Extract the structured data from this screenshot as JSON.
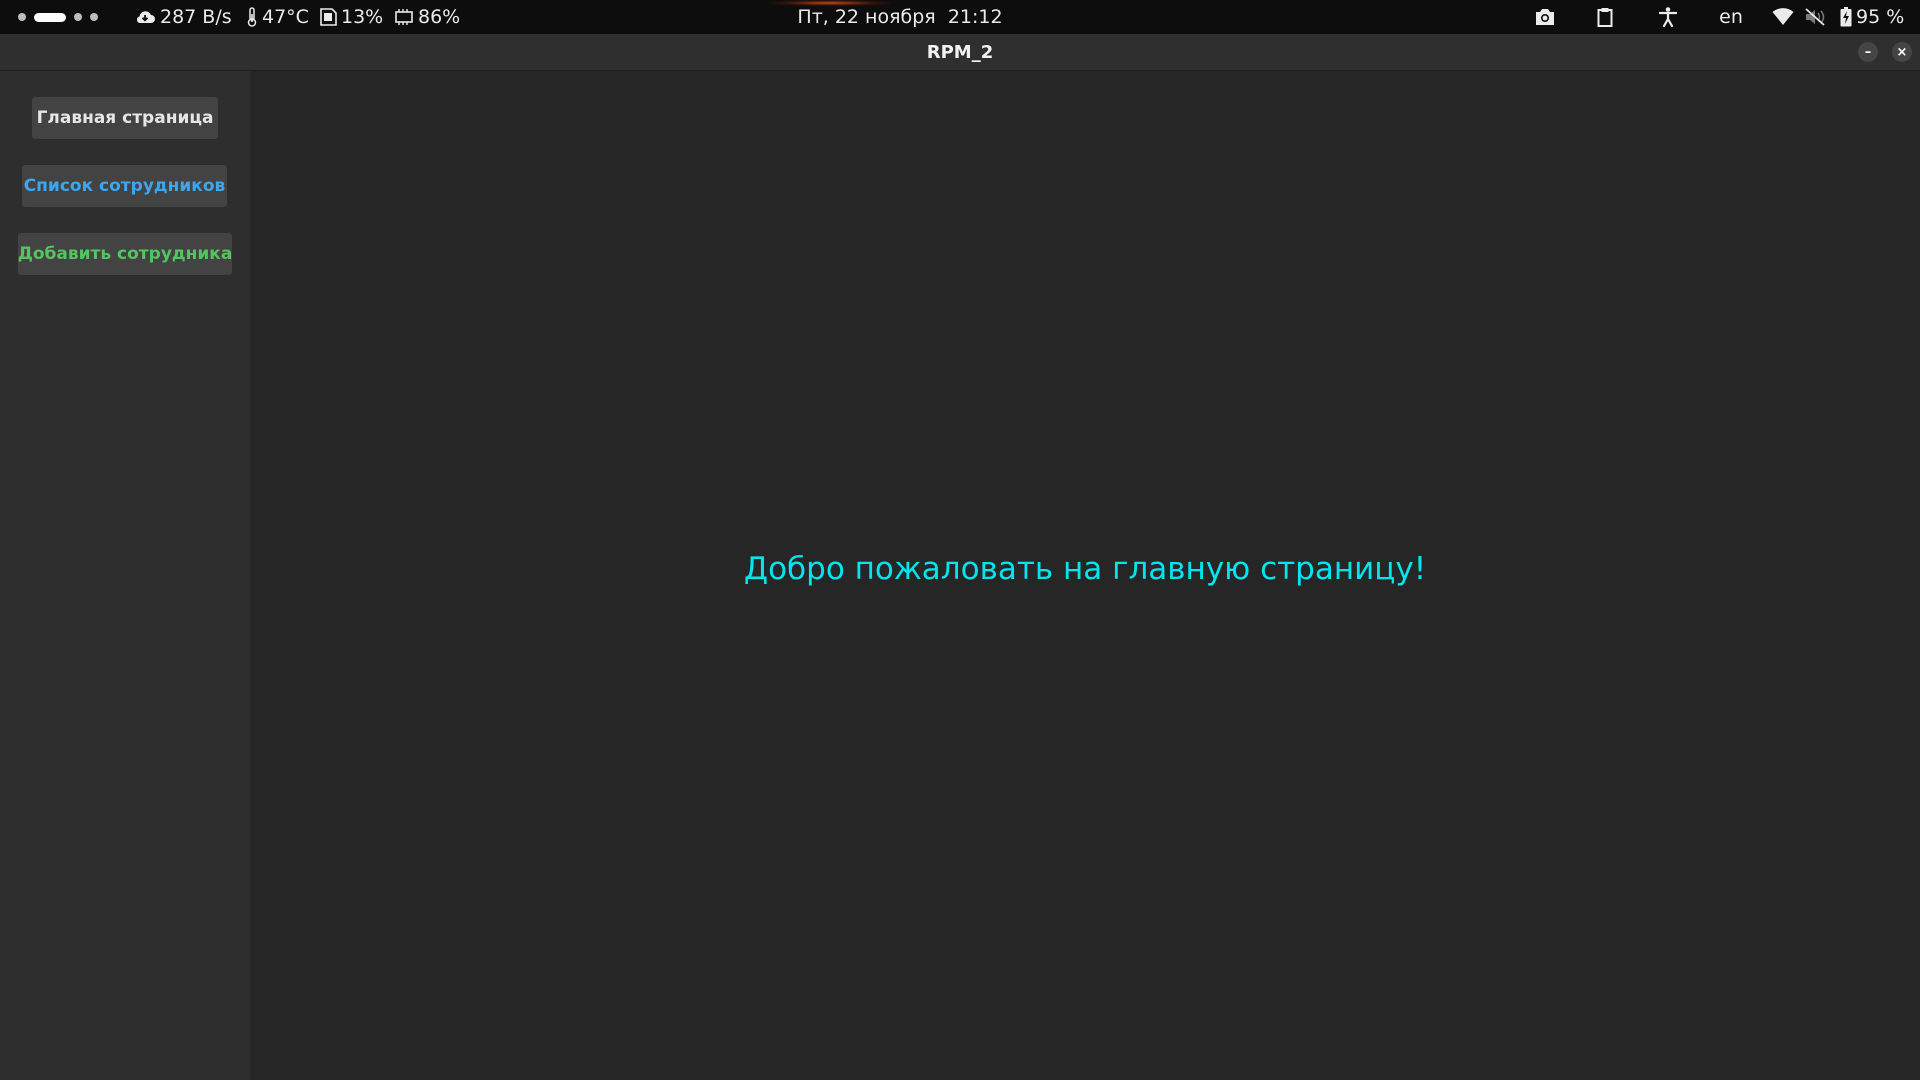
{
  "top_bar": {
    "net_speed": "287 B/s",
    "temperature": "47°C",
    "memory": "13%",
    "cpu": "86%",
    "clock": "Пт, 22 ноября  21:12",
    "keyboard_layout": "en",
    "battery": "95 %"
  },
  "window": {
    "title": "RPM_2",
    "minimize_label": "–",
    "close_label": "×"
  },
  "sidebar": {
    "buttons": [
      {
        "label": "Главная страница",
        "color": "#e6e6e6"
      },
      {
        "label": "Список сотрудников",
        "color": "#3aa7f0"
      },
      {
        "label": "Добавить сотрудника",
        "color": "#54c45e"
      }
    ]
  },
  "main": {
    "welcome_text": "Добро пожаловать на главную страницу!",
    "welcome_color": "#00e5ee"
  }
}
